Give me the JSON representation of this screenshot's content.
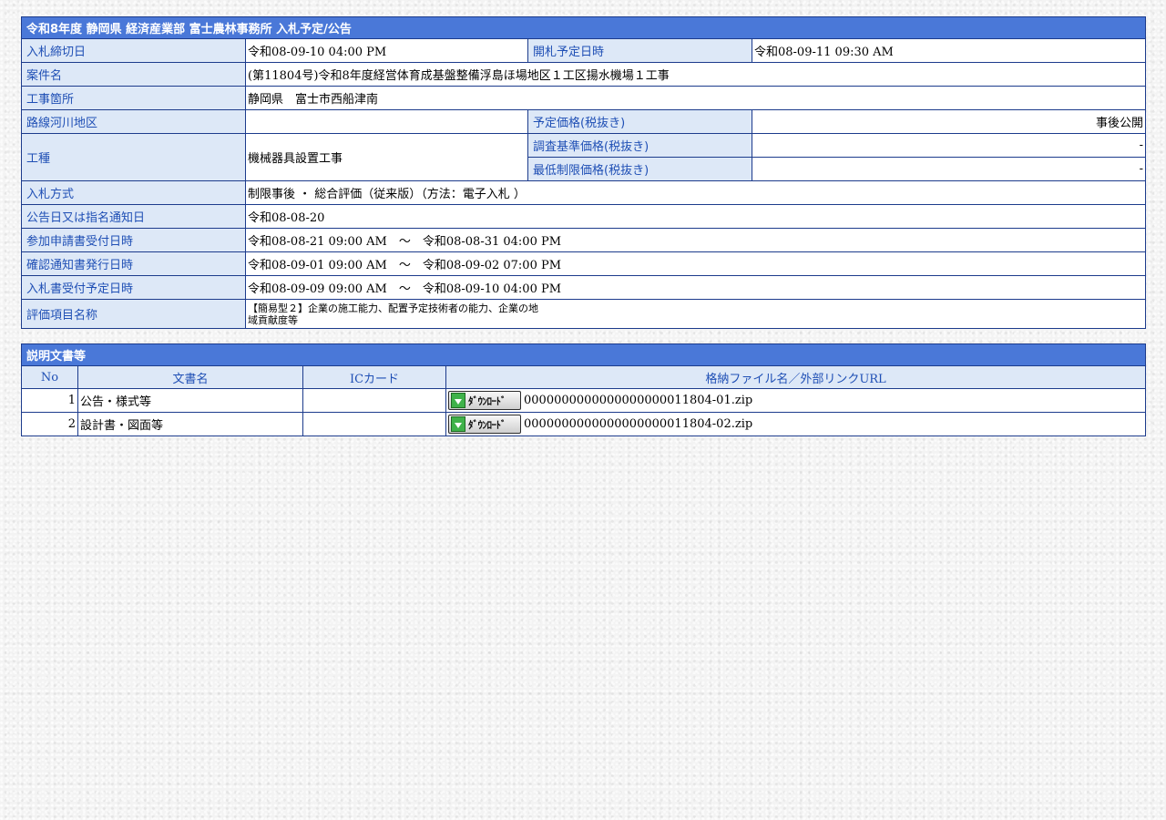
{
  "notice": {
    "title": "令和8年度 静岡県 経済産業部 富士農林事務所 入札予定/公告",
    "bid_deadline_label": "入札締切日",
    "bid_deadline_value": "令和08-09-10 04:00 PM",
    "opening_label": "開札予定日時",
    "opening_value": "令和08-09-11 09:30 AM",
    "project_name_label": "案件名",
    "project_name_value": "(第11804号)令和8年度経営体育成基盤整備浮島ほ場地区１工区揚水機場１工事",
    "location_label": "工事箇所",
    "location_value": "静岡県　富士市西船津南",
    "route_label": "路線河川地区",
    "route_value": "",
    "planned_price_label": "予定価格(税抜き)",
    "planned_price_value": "事後公開",
    "work_type_label": "工種",
    "work_type_value": "機械器具設置工事",
    "survey_price_label": "調査基準価格(税抜き)",
    "survey_price_value": "-",
    "min_price_label": "最低制限価格(税抜き)",
    "min_price_value": "-",
    "method_label": "入札方式",
    "method_value": "制限事後 ・ 総合評価（従来版）（方法：電子入札 ）",
    "announce_label": "公告日又は指名通知日",
    "announce_value": "令和08-08-20",
    "application_label": "参加申請書受付日時",
    "application_value": "令和08-08-21 09:00 AM　～　令和08-08-31 04:00 PM",
    "confirm_label": "確認通知書発行日時",
    "confirm_value": "令和08-09-01 09:00 AM　～　令和08-09-02 07:00 PM",
    "bid_accept_label": "入札書受付予定日時",
    "bid_accept_value": "令和08-09-09 09:00 AM　～　令和08-09-10 04:00 PM",
    "eval_label": "評価項目名称",
    "eval_value_line1": "【簡易型２】企業の施工能力、配置予定技術者の能力、企業の地",
    "eval_value_line2": "域貢献度等"
  },
  "documents": {
    "title": "説明文書等",
    "headers": {
      "no": "No",
      "name": "文書名",
      "iccard": "ICカード",
      "file": "格納ファイル名／外部リンクURL"
    },
    "download_label": "ﾀﾞｳﾝﾛｰﾄﾞ",
    "rows": [
      {
        "no": "1",
        "name": "公告・様式等",
        "iccard": "",
        "file": "0000000000000000000011804-01.zip"
      },
      {
        "no": "2",
        "name": "設計書・図面等",
        "iccard": "",
        "file": "0000000000000000000011804-02.zip"
      }
    ]
  }
}
